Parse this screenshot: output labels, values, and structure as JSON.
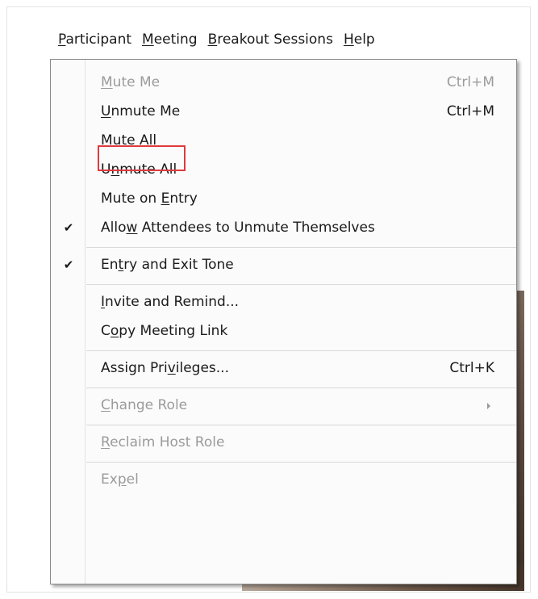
{
  "menubar": [
    {
      "name": "menu-participant",
      "pre": "",
      "key": "P",
      "post": "articipant"
    },
    {
      "name": "menu-meeting",
      "pre": "",
      "key": "M",
      "post": "eeting"
    },
    {
      "name": "menu-breakout-sessions",
      "pre": "",
      "key": "B",
      "post": "reakout Sessions"
    },
    {
      "name": "menu-help",
      "pre": "",
      "key": "H",
      "post": "elp"
    }
  ],
  "items": {
    "mute_me": {
      "pre": "",
      "key": "M",
      "post": "ute Me",
      "shortcut": "Ctrl+M"
    },
    "unmute_me": {
      "pre": "",
      "key": "U",
      "post": "nmute Me",
      "shortcut": "Ctrl+M"
    },
    "mute_all": {
      "pre": "Mute ",
      "key": "A",
      "post": "ll"
    },
    "unmute_all": {
      "pre": "U",
      "key": "n",
      "post": "mute All"
    },
    "mute_on_entry": {
      "pre": "Mute on ",
      "key": "E",
      "post": "ntry"
    },
    "allow_unmute": {
      "pre": "Allo",
      "key": "w",
      "post": " Attendees to Unmute Themselves",
      "check": "✔"
    },
    "entry_exit_tone": {
      "pre": "En",
      "key": "t",
      "post": "ry and Exit Tone",
      "check": "✔"
    },
    "invite_remind": {
      "pre": "",
      "key": "I",
      "post": "nvite and Remind..."
    },
    "copy_link": {
      "pre": "C",
      "key": "o",
      "post": "py Meeting Link"
    },
    "assign_privileges": {
      "pre": "Assign Pri",
      "key": "v",
      "post": "ileges...",
      "shortcut": "Ctrl+K"
    },
    "change_role": {
      "pre": "",
      "key": "C",
      "post": "hange Role"
    },
    "reclaim_host": {
      "pre": "",
      "key": "R",
      "post": "eclaim Host Role"
    },
    "expel": {
      "pre": "Ex",
      "key": "p",
      "post": "el"
    }
  },
  "colors": {
    "highlight_box": "#e0393e",
    "disabled_text": "#9b9b9b",
    "menu_background": "#fbfbfb"
  }
}
